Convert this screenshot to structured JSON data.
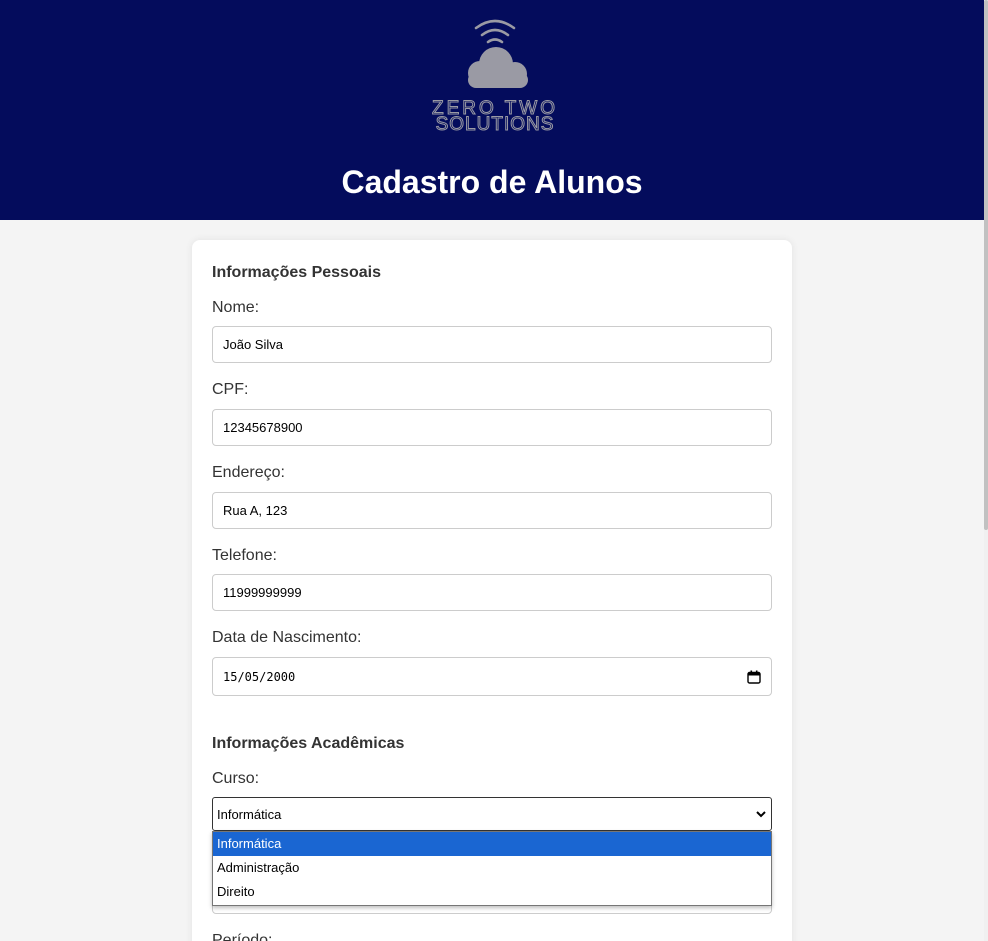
{
  "header": {
    "brand_line1": "ZERO TWO",
    "brand_line2": "SOLUTIONS",
    "title": "Cadastro de Alunos",
    "background": "#040c5c"
  },
  "personal": {
    "section_title": "Informações Pessoais",
    "nome_label": "Nome:",
    "nome_value": "João Silva",
    "cpf_label": "CPF:",
    "cpf_value": "12345678900",
    "endereco_label": "Endereço:",
    "endereco_value": "Rua A, 123",
    "telefone_label": "Telefone:",
    "telefone_value": "11999999999",
    "nascimento_label": "Data de Nascimento:",
    "nascimento_value": "15/05/2000"
  },
  "academic": {
    "section_title": "Informações Acadêmicas",
    "curso_label": "Curso:",
    "curso_selected": "Informática",
    "curso_options": [
      "Informática",
      "Administração",
      "Direito"
    ],
    "periodo_label": "Período:"
  },
  "colors": {
    "selected_option": "#1a66d2"
  }
}
